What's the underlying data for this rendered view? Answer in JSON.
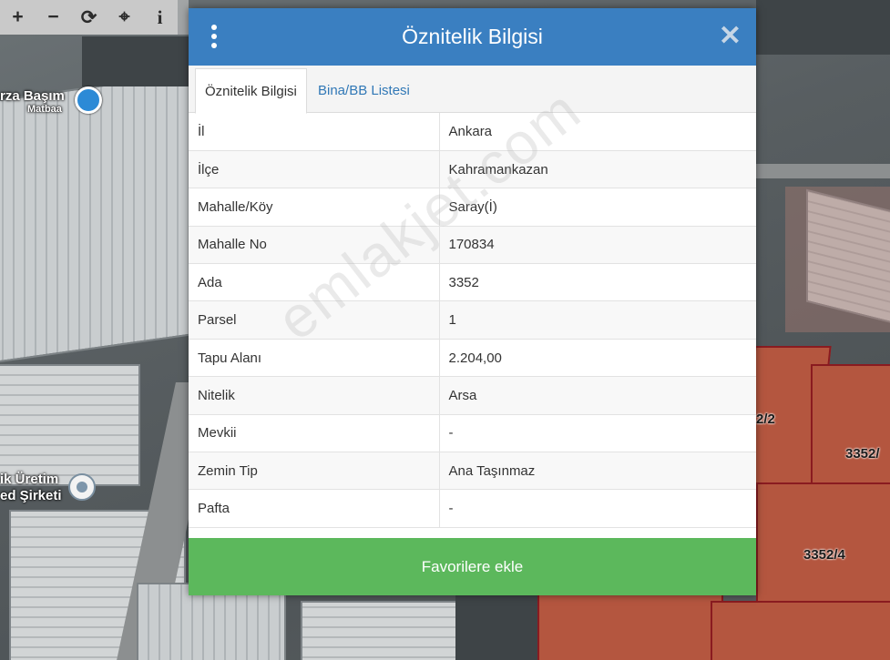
{
  "toolbar": {
    "zoom_in": "+",
    "zoom_out": "−",
    "refresh": "⟳",
    "locate": "⌖",
    "info": "i"
  },
  "map": {
    "labels": {
      "place1_line1": "rza Başım",
      "place1_line2": "Matbaa",
      "place2_line1": "ik Üretim",
      "place2_line2": "ed Şirketi"
    },
    "parcels": [
      "2/2",
      "3352/",
      "3352/4",
      "3352/"
    ]
  },
  "modal": {
    "title": "Öznitelik Bilgisi",
    "tabs": [
      {
        "label": "Öznitelik Bilgisi",
        "active": true
      },
      {
        "label": "Bina/BB Listesi",
        "active": false
      }
    ],
    "rows": [
      {
        "key": "İl",
        "value": "Ankara"
      },
      {
        "key": "İlçe",
        "value": "Kahramankazan"
      },
      {
        "key": "Mahalle/Köy",
        "value": "Saray(İ)"
      },
      {
        "key": "Mahalle No",
        "value": "170834"
      },
      {
        "key": "Ada",
        "value": "3352"
      },
      {
        "key": "Parsel",
        "value": "1"
      },
      {
        "key": "Tapu Alanı",
        "value": "2.204,00"
      },
      {
        "key": "Nitelik",
        "value": "Arsa"
      },
      {
        "key": "Mevkii",
        "value": "-"
      },
      {
        "key": "Zemin Tip",
        "value": "Ana Taşınmaz"
      },
      {
        "key": "Pafta",
        "value": "-"
      }
    ],
    "favorite_button": "Favorilere ekle",
    "watermark": "emlakjet.com"
  },
  "colors": {
    "header": "#3a7fc1",
    "favorite": "#5cb85c",
    "tab_link": "#3178b6"
  }
}
